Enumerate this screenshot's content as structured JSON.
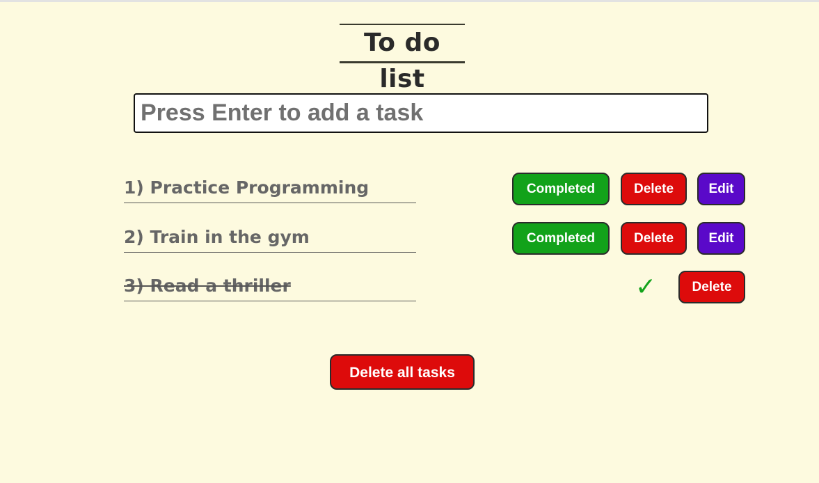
{
  "title": "To do list",
  "input": {
    "placeholder": "Press Enter to add a task",
    "value": ""
  },
  "tasks": [
    {
      "label": "1) Practice Programming",
      "completed": false,
      "completed_label": "Completed",
      "delete_label": "Delete",
      "edit_label": "Edit"
    },
    {
      "label": "2) Train in the gym",
      "completed": false,
      "completed_label": "Completed",
      "delete_label": "Delete",
      "edit_label": "Edit"
    },
    {
      "label": "3) Read a thriller",
      "completed": true,
      "check_icon": "checkmark-icon",
      "check_glyph": "✓",
      "delete_label": "Delete"
    }
  ],
  "delete_all_label": "Delete all tasks",
  "colors": {
    "background": "#fdfadf",
    "completed": "#12a21a",
    "delete": "#dd0b0b",
    "edit": "#5a09c9",
    "check": "#13a31b"
  }
}
